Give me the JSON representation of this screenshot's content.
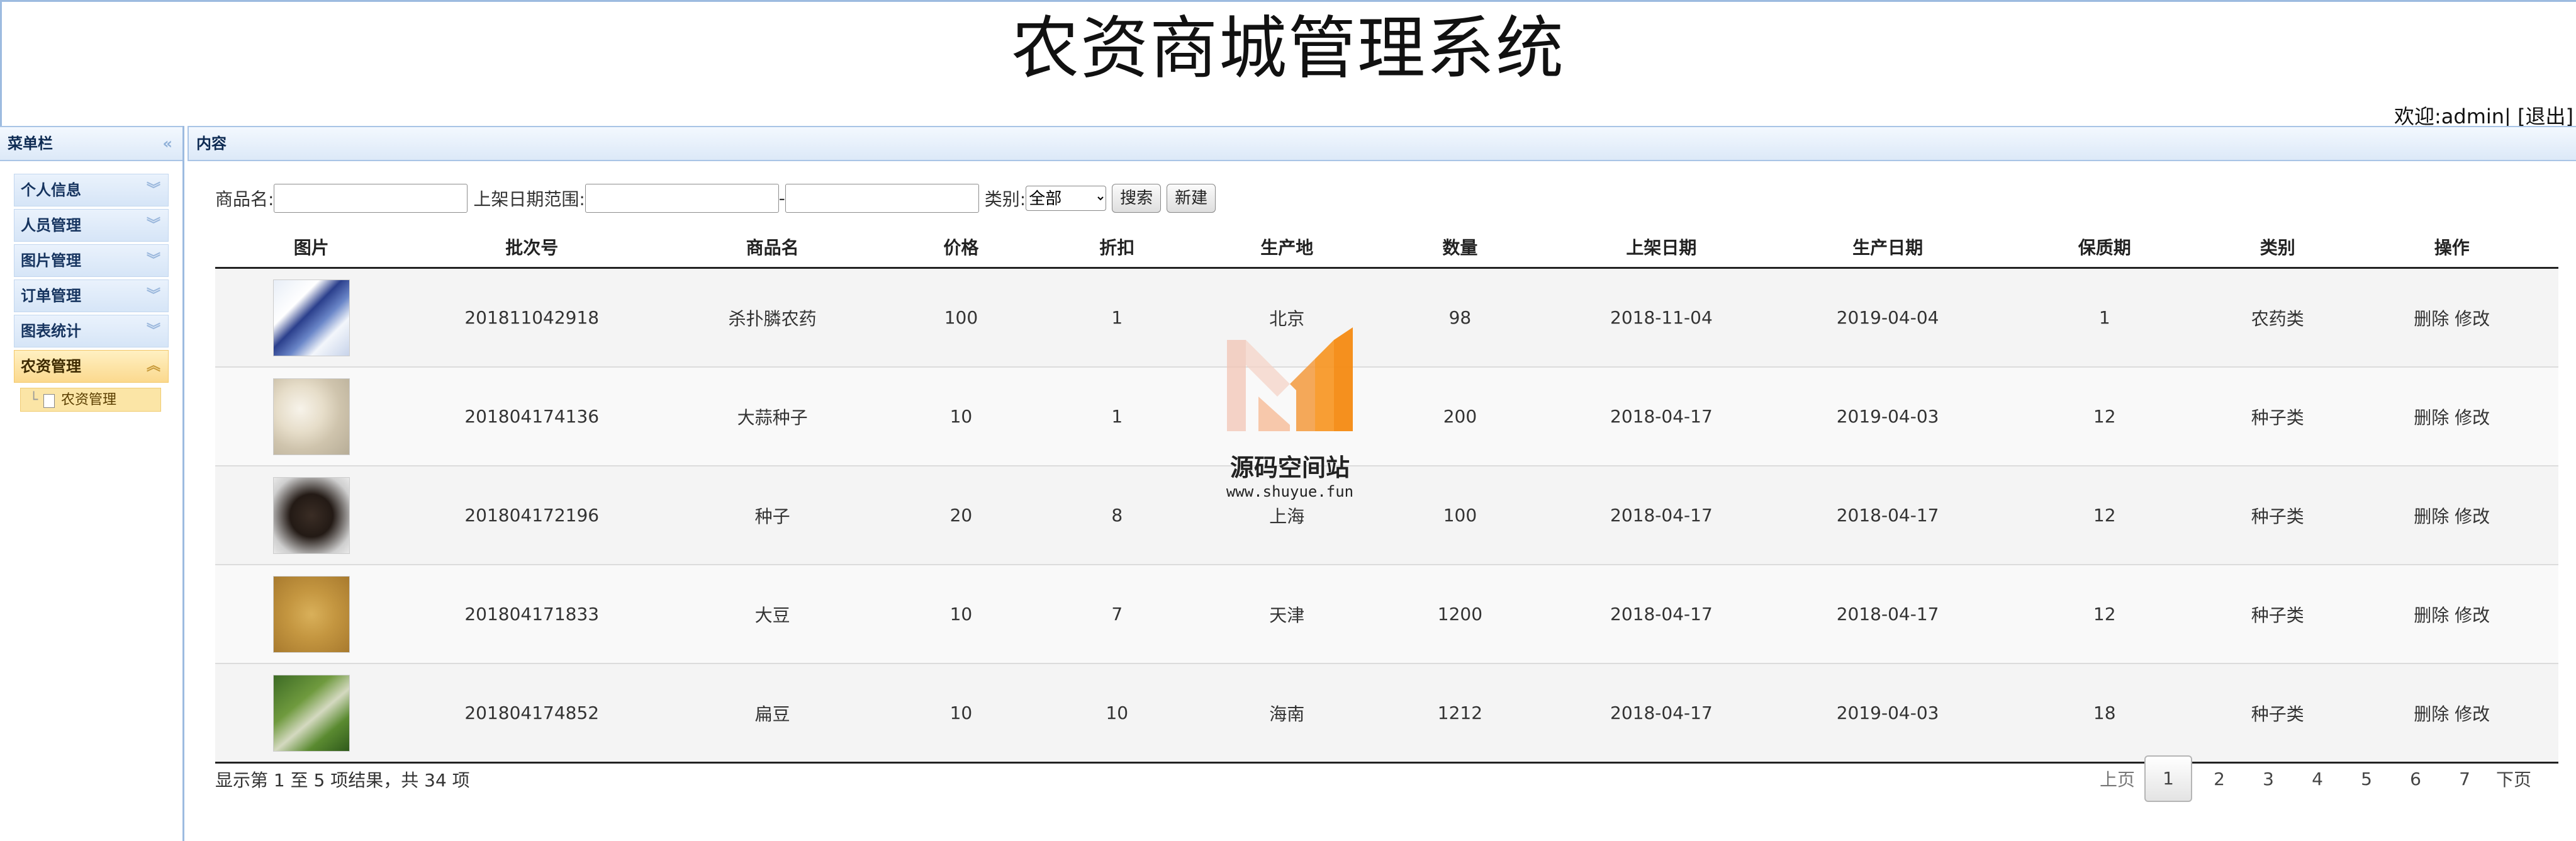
{
  "app": {
    "title": "农资商城管理系统",
    "welcome": "欢迎:admin|",
    "logout": "[退出]"
  },
  "sidebar": {
    "header": "菜单栏",
    "items": [
      {
        "label": "个人信息"
      },
      {
        "label": "人员管理"
      },
      {
        "label": "图片管理"
      },
      {
        "label": "订单管理"
      },
      {
        "label": "图表统计"
      },
      {
        "label": "农资管理",
        "active": true
      }
    ],
    "submenu": {
      "label": "农资管理"
    }
  },
  "content": {
    "header": "内容"
  },
  "filters": {
    "name_label": "商品名:",
    "name_value": "",
    "date_label": "上架日期范围:",
    "date_from": "",
    "date_sep": "-",
    "date_to": "",
    "category_label": "类别:",
    "category_value": "全部",
    "search_label": "搜索",
    "new_label": "新建"
  },
  "table": {
    "headers": [
      "图片",
      "批次号",
      "商品名",
      "价格",
      "折扣",
      "生产地",
      "数量",
      "上架日期",
      "生产日期",
      "保质期",
      "类别",
      "操作"
    ],
    "delete_label": "删除",
    "edit_label": "修改",
    "rows": [
      {
        "image": "pesticide-bottle-photo",
        "batch": "201811042918",
        "name": "杀扑膦农药",
        "price": "100",
        "discount": "1",
        "origin": "北京",
        "qty": "98",
        "listed": "2018-11-04",
        "produced": "2019-04-04",
        "shelf": "1",
        "category": "农药类"
      },
      {
        "image": "garlic-bulbs-photo",
        "batch": "201804174136",
        "name": "大蒜种子",
        "price": "10",
        "discount": "1",
        "origin": "",
        "qty": "200",
        "listed": "2018-04-17",
        "produced": "2019-04-03",
        "shelf": "12",
        "category": "种子类"
      },
      {
        "image": "dark-seeds-photo",
        "batch": "201804172196",
        "name": "种子",
        "price": "20",
        "discount": "8",
        "origin": "上海",
        "qty": "100",
        "listed": "2018-04-17",
        "produced": "2018-04-17",
        "shelf": "12",
        "category": "种子类"
      },
      {
        "image": "soybeans-photo",
        "batch": "201804171833",
        "name": "大豆",
        "price": "10",
        "discount": "7",
        "origin": "天津",
        "qty": "1200",
        "listed": "2018-04-17",
        "produced": "2018-04-17",
        "shelf": "12",
        "category": "种子类"
      },
      {
        "image": "bean-pods-photo",
        "batch": "201804174852",
        "name": "扁豆",
        "price": "10",
        "discount": "10",
        "origin": "海南",
        "qty": "1212",
        "listed": "2018-04-17",
        "produced": "2019-04-03",
        "shelf": "18",
        "category": "种子类"
      }
    ]
  },
  "footer": {
    "info": "显示第 1 至 5 项结果，共 34 项",
    "prev": "上页",
    "pages": [
      "1",
      "2",
      "3",
      "4",
      "5",
      "6",
      "7"
    ],
    "current": "1",
    "next": "下页"
  },
  "watermark": {
    "cn": "源码空间站",
    "url": "www.shuyue.fun"
  }
}
